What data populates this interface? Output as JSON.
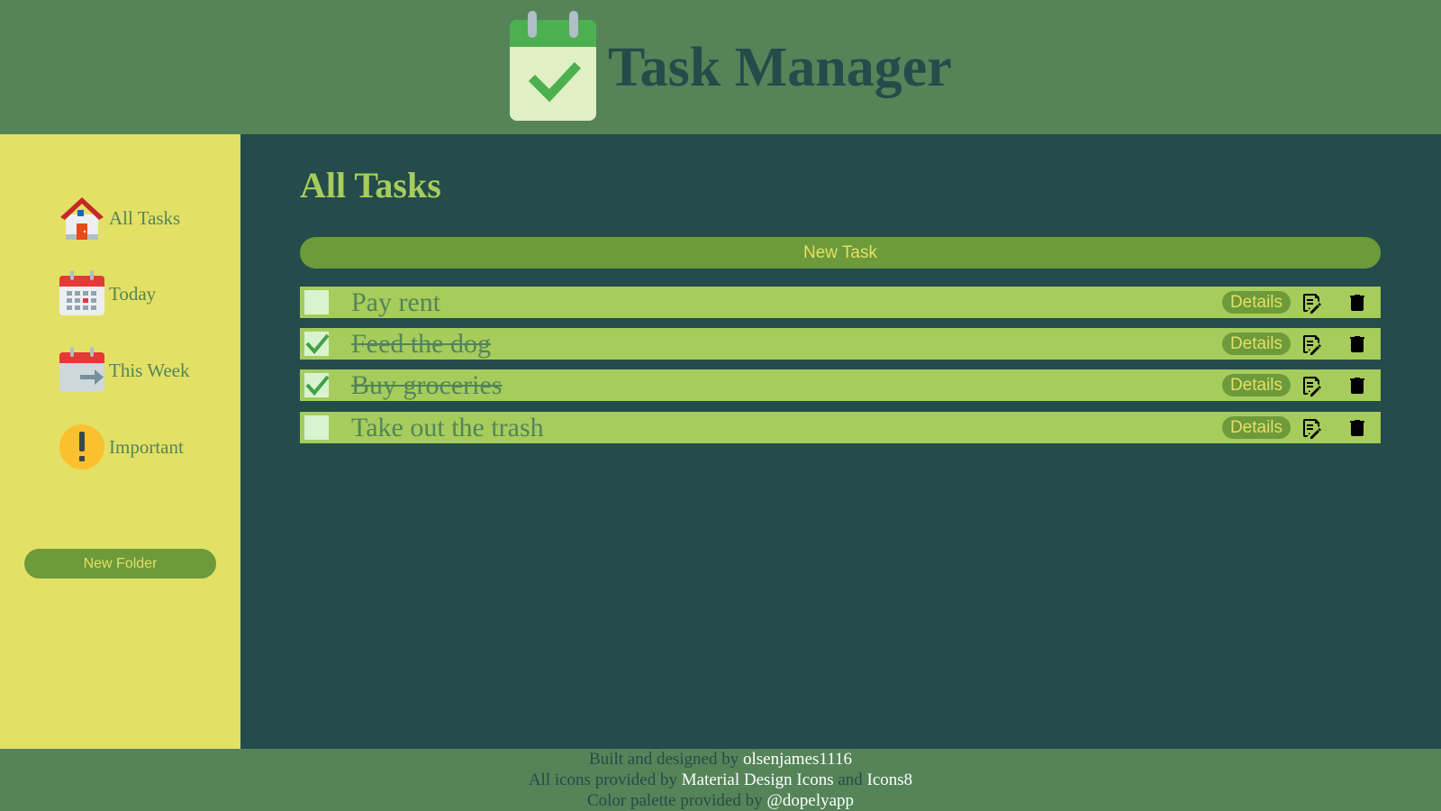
{
  "app": {
    "title": "Task Manager",
    "logo_icon": "calendar-check-icon"
  },
  "sidebar": {
    "items": [
      {
        "label": "All Tasks",
        "icon": "house-icon"
      },
      {
        "label": "Today",
        "icon": "calendar-icon"
      },
      {
        "label": "This Week",
        "icon": "calendar-arrow-icon"
      },
      {
        "label": "Important",
        "icon": "exclamation-icon"
      }
    ],
    "new_folder_label": "New Folder"
  },
  "main": {
    "page_title": "All Tasks",
    "new_task_label": "New Task",
    "tasks": [
      {
        "title": "Pay rent",
        "done": false,
        "details_label": "Details"
      },
      {
        "title": "Feed the dog",
        "done": true,
        "details_label": "Details"
      },
      {
        "title": "Buy groceries",
        "done": true,
        "details_label": "Details"
      },
      {
        "title": "Take out the trash",
        "done": false,
        "details_label": "Details"
      }
    ]
  },
  "footer": {
    "line1_prefix": "Built and designed by ",
    "line1_link": "olsenjames1116",
    "line2_prefix": "All icons provided by ",
    "line2_link1": "Material Design Icons",
    "line2_mid": " and ",
    "line2_link2": "Icons8",
    "line3_prefix": "Color palette provided by ",
    "line3_link": "@dopelyapp"
  },
  "colors": {
    "header_bg": "#548458",
    "sidebar_bg": "#e3e066",
    "main_bg": "#244c4a",
    "accent_green": "#a6cc5c",
    "button_green": "#6d9a3a"
  }
}
